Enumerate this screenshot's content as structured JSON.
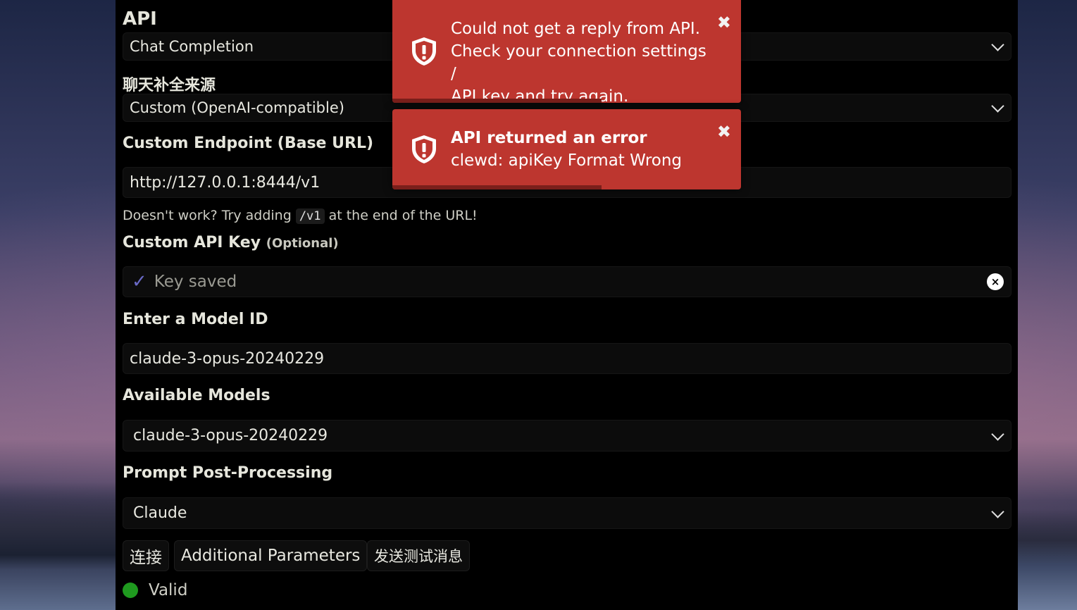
{
  "api": {
    "label": "API",
    "value": "Chat Completion"
  },
  "source": {
    "label": "聊天补全来源",
    "value": "Custom (OpenAI-compatible)"
  },
  "endpoint": {
    "label": "Custom Endpoint (Base URL)",
    "value": "http://127.0.0.1:8444/v1",
    "hint_before": "Doesn't work? Try adding",
    "hint_code": "/v1",
    "hint_after": "at the end of the URL!"
  },
  "api_key": {
    "label": "Custom API Key",
    "optional": "(Optional)",
    "saved_text": "Key saved",
    "check_icon": "✓",
    "clear_icon": "×"
  },
  "model_id": {
    "label": "Enter a Model ID",
    "value": "claude-3-opus-20240229"
  },
  "available_models": {
    "label": "Available Models",
    "value": "claude-3-opus-20240229"
  },
  "post_processing": {
    "label": "Prompt Post-Processing",
    "value": "Claude"
  },
  "buttons": {
    "connect": "连接",
    "additional": "Additional Parameters",
    "test": "发送测试消息"
  },
  "status": {
    "text": "Valid",
    "color": "#1f9a1f"
  },
  "toasts": [
    {
      "lines": [
        "Could not get a reply from API.",
        "Check your connection settings /",
        "API key and try again."
      ],
      "close": "✖",
      "progress": 0.6
    },
    {
      "title": "API returned an error",
      "body": "clewd: apiKey Format Wrong",
      "close": "✖",
      "progress": 0.6
    }
  ],
  "colors": {
    "toast_bg": "#bd362f",
    "accent_check": "#6a6ac8"
  }
}
